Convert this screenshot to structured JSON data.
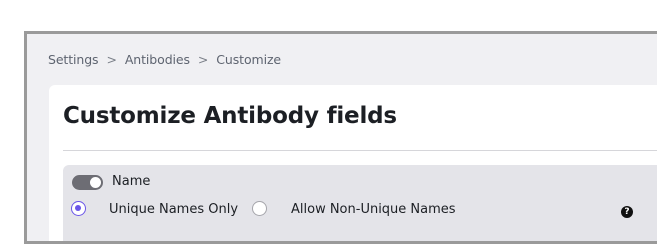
{
  "breadcrumb": {
    "items": [
      "Settings",
      "Antibodies",
      "Customize"
    ],
    "separator": ">"
  },
  "page": {
    "title": "Customize Antibody fields"
  },
  "name_field": {
    "toggle_label": "Name",
    "toggle_on": true,
    "options": [
      {
        "label": "Unique Names Only",
        "selected": true
      },
      {
        "label": "Allow Non-Unique Names",
        "selected": false
      }
    ],
    "help_icon_glyph": "?"
  },
  "colors": {
    "accent": "#6a55e8",
    "toggle_track": "#6d6d74",
    "panel_bg": "#e4e4e9"
  }
}
